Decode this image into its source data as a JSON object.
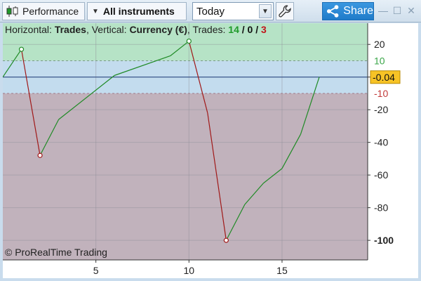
{
  "toolbar": {
    "performance_label": "Performance",
    "instruments_label": "All instruments",
    "period_value": "Today",
    "share_label": "Share",
    "icons": [
      "candlestick-icon",
      "caret-down-icon",
      "wrench-icon",
      "share-icon",
      "minimize-icon",
      "maximize-icon",
      "close-icon"
    ]
  },
  "header": {
    "horizontal_label": "Horizontal:",
    "horizontal_value": "Trades",
    "vertical_label": "Vertical:",
    "vertical_value": "Currency (€)",
    "trades_label": "Trades:",
    "trades_green": "14",
    "trades_black": "0",
    "trades_red": "3",
    "sep1": ",",
    "sep2": ",",
    "slash": "/"
  },
  "copyright": "© ProRealTime Trading",
  "colors": {
    "gain_zone": "#b6e3c6",
    "neutral_zone": "#c3dcee",
    "loss_zone": "#c1b2bc",
    "up_line": "#1f8a25",
    "down_line": "#a01818",
    "current_value_bg": "#f7c326"
  },
  "chart_data": {
    "type": "line",
    "x": [
      0,
      1,
      2,
      3,
      6,
      9,
      10,
      11,
      12,
      13,
      14,
      15,
      16,
      17
    ],
    "y": [
      0,
      17,
      -48,
      -26,
      1,
      13,
      22,
      -22,
      -100,
      -78,
      -65,
      -56,
      -35,
      0
    ],
    "marked_points": [
      [
        1,
        17
      ],
      [
        2,
        -48
      ],
      [
        10,
        22
      ],
      [
        12,
        -100
      ]
    ],
    "xlim": [
      0,
      19.6
    ],
    "ylim": [
      -112,
      33
    ],
    "x_ticks": [
      5,
      10,
      15
    ],
    "y_ticks": [
      20,
      0,
      -20,
      -40,
      -60,
      -80,
      -100
    ],
    "y_tick_labels": [
      "20",
      "",
      "-20",
      "-40",
      "-60",
      "-80",
      "-100"
    ],
    "bold_y_tick": -100,
    "threshold_upper": 10,
    "threshold_lower": -10,
    "threshold_labels": [
      "10",
      "-10"
    ],
    "current_value": -0.04,
    "current_value_label": "-0.04",
    "xlabel": "Trades",
    "ylabel": "Currency (€)",
    "grid": true
  }
}
